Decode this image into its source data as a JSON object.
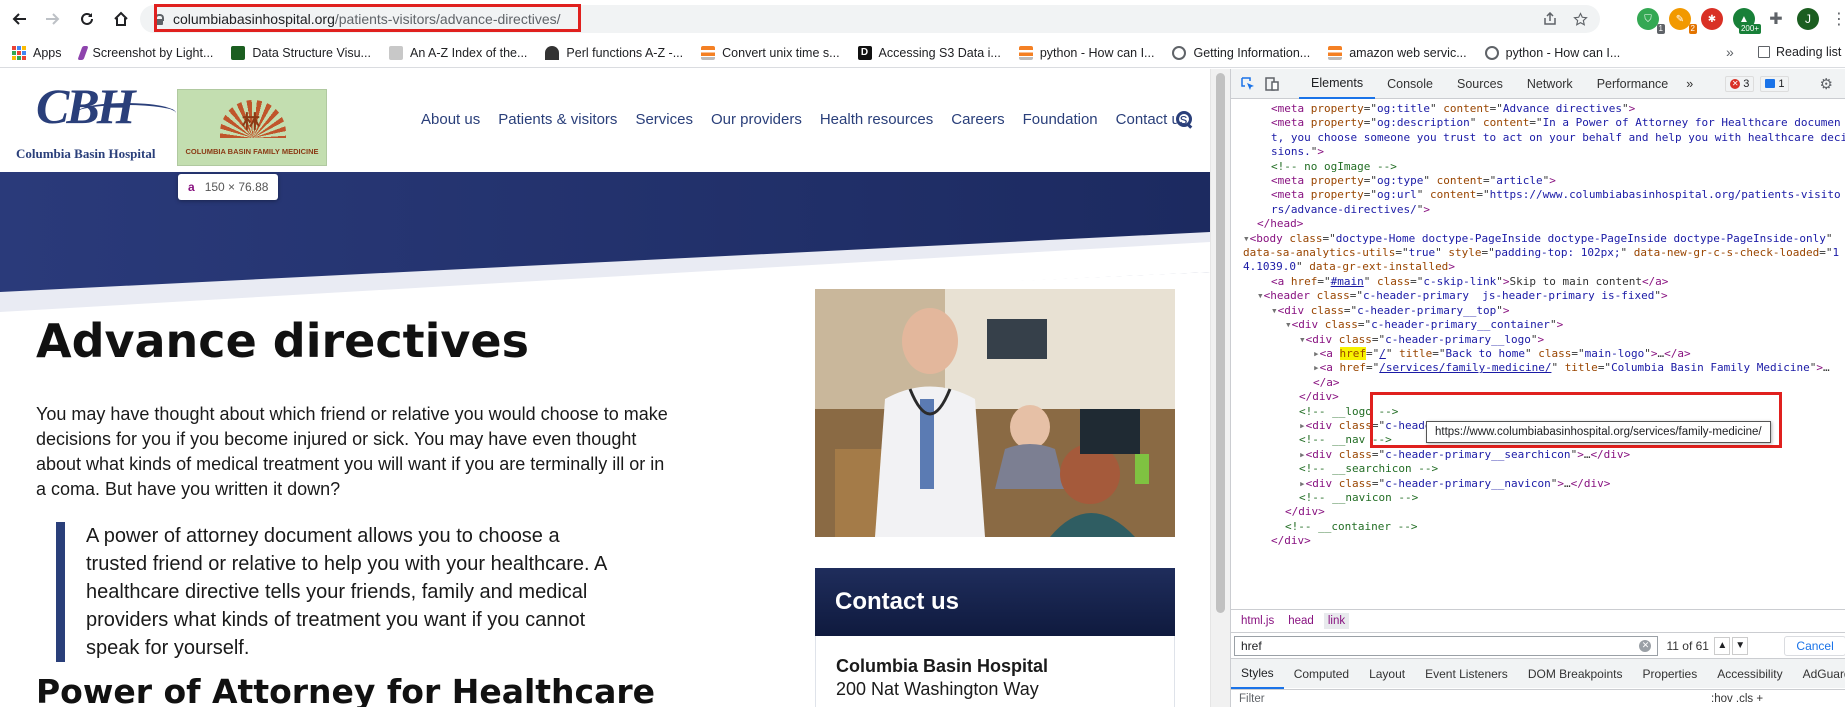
{
  "browser": {
    "url_domain": "columbiabasinhospital.org",
    "url_path": "/patients-visitors/advance-directives/",
    "extensions": [
      {
        "name": "shield-extension-icon",
        "badge": "1",
        "color": "#34a853"
      },
      {
        "name": "screenshot-extension-icon",
        "badge": "2",
        "color": "#f29900"
      },
      {
        "name": "red-extension-icon",
        "badge": "",
        "color": "#d93025"
      },
      {
        "name": "counter-extension-icon",
        "badge": "200+",
        "color": "#188038"
      }
    ],
    "profile_initial": "J"
  },
  "bookmarks": {
    "items": [
      {
        "label": "Apps",
        "icon": "apps-grid-icon"
      },
      {
        "label": "Screenshot by Light...",
        "icon": "feather-icon",
        "color": "#8e44ad"
      },
      {
        "label": "Data Structure Visu...",
        "icon": "usf-icon",
        "color": "#1b5e20"
      },
      {
        "label": "An A-Z Index of the...",
        "icon": "page-icon",
        "color": "#c8c8c8"
      },
      {
        "label": "Perl functions A-Z -...",
        "icon": "camel-icon",
        "color": "#333333"
      },
      {
        "label": "Convert unix time s...",
        "icon": "stack-icon",
        "color": "#f48024"
      },
      {
        "label": "Accessing S3 Data i...",
        "icon": "d-icon",
        "color": "#111111"
      },
      {
        "label": "python - How can I...",
        "icon": "stack-icon",
        "color": "#f48024"
      },
      {
        "label": "Getting Information...",
        "icon": "globe-icon",
        "color": "#5f6368"
      },
      {
        "label": "amazon web servic...",
        "icon": "stack-icon",
        "color": "#f48024"
      },
      {
        "label": "python - How can I...",
        "icon": "globe-icon",
        "color": "#5f6368"
      }
    ],
    "more": "»",
    "reading_list": "Reading list"
  },
  "site": {
    "logo_text": "Columbia Basin Hospital",
    "logo_mark": "CBH",
    "partner_logo_text": "COLUMBIA BASIN FAMILY MEDICINE",
    "nav": [
      "About us",
      "Patients & visitors",
      "Services",
      "Our providers",
      "Health resources",
      "Careers",
      "Foundation",
      "Contact us"
    ],
    "inspect_tooltip": {
      "tag": "a",
      "dims": "150 × 76.88"
    },
    "title": "Advance directives",
    "intro": "You may have thought about which friend or relative you would choose to make decisions for you if you become injured or sick. You may have even thought about what kinds of medical treatment you will want if you are terminally ill or in a coma. But have you written it down?",
    "quote": "A power of attorney document allows you to choose a trusted friend or relative to help you with your healthcare. A healthcare directive tells your friends, family and medical providers what kinds of treatment you want if you cannot speak for yourself.",
    "subheading": "Power of Attorney for Healthcare",
    "contact_heading": "Contact us",
    "contact_org": "Columbia Basin Hospital",
    "contact_address": "200 Nat Washington Way",
    "brand_color": "#2a3f7a"
  },
  "devtools": {
    "tabs": [
      "Elements",
      "Console",
      "Sources",
      "Network",
      "Performance"
    ],
    "more_tabs": "»",
    "error_count": "3",
    "message_count": "1",
    "code_lines": [
      {
        "indent": 2,
        "html": "<span class='tg'>&lt;meta</span> <span class='an'>property</span>=\"<span class='av'>og:title</span>\" <span class='an'>content</span>=\"<span class='av'>Advance directives</span>\"<span class='tg'>&gt;</span>"
      },
      {
        "indent": 2,
        "html": "<span class='tg'>&lt;meta</span> <span class='an'>property</span>=\"<span class='av'>og:description</span>\" <span class='an'>content</span>=\"<span class='av'>In a Power of Attorney for Healthcare documen</span>"
      },
      {
        "indent": 2,
        "html": "<span class='av'>t, you choose someone you trust to act on your behalf and help you with healthcare deci</span>"
      },
      {
        "indent": 2,
        "html": "<span class='av'>sions.</span>\"<span class='tg'>&gt;</span>"
      },
      {
        "indent": 2,
        "html": "<span class='cm'>&lt;!-- no ogImage --&gt;</span>"
      },
      {
        "indent": 2,
        "html": "<span class='tg'>&lt;meta</span> <span class='an'>property</span>=\"<span class='av'>og:type</span>\" <span class='an'>content</span>=\"<span class='av'>article</span>\"<span class='tg'>&gt;</span>"
      },
      {
        "indent": 2,
        "html": "<span class='tg'>&lt;meta</span> <span class='an'>property</span>=\"<span class='av'>og:url</span>\" <span class='an'>content</span>=\"<span class='av'>https://www.columbiabasinhospital.org/patients-visito</span>"
      },
      {
        "indent": 2,
        "html": "<span class='av'>rs/advance-directives/</span>\"<span class='tg'>&gt;</span>"
      },
      {
        "indent": 1,
        "html": "<span class='tg'>&lt;/head&gt;</span>"
      },
      {
        "indent": 0,
        "html": "<span class='tri'>▾</span><span class='tg'>&lt;body</span> <span class='an'>class</span>=\"<span class='av'>doctype-Home doctype-PageInside doctype-PageInside doctype-PageInside-only</span>\""
      },
      {
        "indent": 0,
        "html": "<span class='an'>data-sa-analytics-utils</span>=\"<span class='av'>true</span>\" <span class='an'>style</span>=\"<span class='av'>padding-top: 102px;</span>\" <span class='an'>data-new-gr-c-s-check-loaded</span>=\"<span class='av'>1</span>"
      },
      {
        "indent": 0,
        "html": "<span class='av'>4.1039.0</span>\" <span class='an'>data-gr-ext-installed</span><span class='tg'>&gt;</span>"
      },
      {
        "indent": 2,
        "html": "<span class='tg'>&lt;a</span> <span class='an'>href</span>=\"<span class='lk'>#main</span>\" <span class='an'>class</span>=\"<span class='av'>c-skip-link</span>\"<span class='tg'>&gt;</span>Skip to main content<span class='tg'>&lt;/a&gt;</span>"
      },
      {
        "indent": 1,
        "html": "<span class='tri'>▾</span><span class='tg'>&lt;header</span> <span class='an'>class</span>=\"<span class='av'>c-header-primary  js-header-primary is-fixed</span>\"<span class='tg'>&gt;</span>"
      },
      {
        "indent": 2,
        "html": "<span class='tri'>▾</span><span class='tg'>&lt;div</span> <span class='an'>class</span>=\"<span class='av'>c-header-primary__top</span>\"<span class='tg'>&gt;</span>"
      },
      {
        "indent": 3,
        "html": "<span class='tri'>▾</span><span class='tg'>&lt;div</span> <span class='an'>class</span>=\"<span class='av'>c-header-primary__container</span>\"<span class='tg'>&gt;</span>"
      },
      {
        "indent": 4,
        "html": "<span class='tri'>▾</span><span class='tg'>&lt;div</span> <span class='an'>class</span>=\"<span class='av'>c-header-primary__logo</span>\"<span class='tg'>&gt;</span>"
      },
      {
        "indent": 5,
        "html": "<span class='tri'>▸</span><span class='tg'>&lt;a</span> <span class='an hl'>href</span>=\"<span class='lk'>/</span>\" <span class='an'>title</span>=\"<span class='av'>Back to home</span>\" <span class='an'>class</span>=\"<span class='av'>main-logo</span>\"<span class='tg'>&gt;</span>…<span class='tg'>&lt;/a&gt;</span>"
      },
      {
        "indent": 5,
        "html": "<span class='tri'>▸</span><span class='tg'>&lt;a</span> <span class='an'>href</span>=\"<span class='lk'>/services/family-medicine/</span>\" <span class='an'>title</span>=\"<span class='av'>Columbia Basin Family Medicine</span>\"<span class='tg'>&gt;</span>…"
      },
      {
        "indent": 5,
        "html": "<span class='tg'>&lt;/a&gt;</span>"
      },
      {
        "indent": 4,
        "html": "<span class='tg'>&lt;/div&gt;</span>"
      },
      {
        "indent": 4,
        "html": "<span class='cm'>&lt;!-- __logo --&gt;</span>"
      },
      {
        "indent": 4,
        "html": "<span class='tri'>▸</span><span class='tg'>&lt;div</span> <span class='an'>class</span>=\"<span class='av'>c-header-primary__nav</span>\"<span class='tg'>&gt;</span>…<span class='tg'>&lt;/div&gt;</span>"
      },
      {
        "indent": 4,
        "html": "<span class='cm'>&lt;!-- __nav --&gt;</span>"
      },
      {
        "indent": 4,
        "html": "<span class='tri'>▸</span><span class='tg'>&lt;div</span> <span class='an'>class</span>=\"<span class='av'>c-header-primary__searchicon</span>\"<span class='tg'>&gt;</span>…<span class='tg'>&lt;/div&gt;</span>"
      },
      {
        "indent": 4,
        "html": "<span class='cm'>&lt;!-- __searchicon --&gt;</span>"
      },
      {
        "indent": 4,
        "html": "<span class='tri'>▸</span><span class='tg'>&lt;div</span> <span class='an'>class</span>=\"<span class='av'>c-header-primary__navicon</span>\"<span class='tg'>&gt;</span>…<span class='tg'>&lt;/div&gt;</span>"
      },
      {
        "indent": 4,
        "html": "<span class='cm'>&lt;!-- __navicon --&gt;</span>"
      },
      {
        "indent": 3,
        "html": "<span class='tg'>&lt;/div&gt;</span>"
      },
      {
        "indent": 3,
        "html": "<span class='cm'>&lt;!-- __container --&gt;</span>"
      },
      {
        "indent": 2,
        "html": "<span class='tg'>&lt;/div&gt;</span>"
      }
    ],
    "link_tooltip": "https://www.columbiabasinhospital.org/services/family-medicine/",
    "breadcrumbs": [
      "html.js",
      "head",
      "link"
    ],
    "search_value": "href",
    "search_count": "11 of 61",
    "cancel_label": "Cancel",
    "lower_tabs": [
      "Styles",
      "Computed",
      "Layout",
      "Event Listeners",
      "DOM Breakpoints",
      "Properties",
      "Accessibility",
      "AdGuard"
    ],
    "filter_placeholder": "Filter",
    "filter_right": ":hov  .cls  +"
  }
}
